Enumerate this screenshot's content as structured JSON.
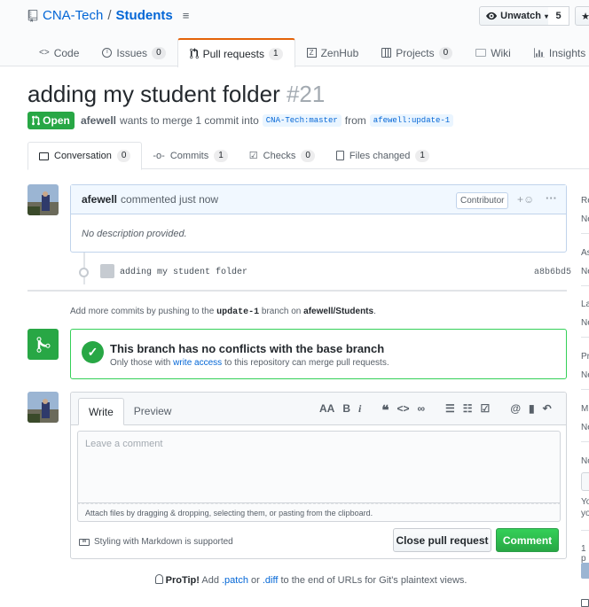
{
  "repo": {
    "owner": "CNA-Tech",
    "separator": "/",
    "name": "Students"
  },
  "watch": {
    "label": "Unwatch",
    "count": "5",
    "star_label": "★"
  },
  "repo_tabs": [
    {
      "label": "Code",
      "count": ""
    },
    {
      "label": "Issues",
      "count": "0"
    },
    {
      "label": "Pull requests",
      "count": "1"
    },
    {
      "label": "ZenHub",
      "count": ""
    },
    {
      "label": "Projects",
      "count": "0"
    },
    {
      "label": "Wiki",
      "count": ""
    },
    {
      "label": "Insights",
      "count": ""
    }
  ],
  "pr": {
    "title": "adding my student folder",
    "number": "#21",
    "state": "Open",
    "author": "afewell",
    "meta_text": "wants to merge 1 commit into",
    "base_ref": "CNA-Tech:master",
    "from_text": "from",
    "head_ref": "afewell:update-1"
  },
  "pr_tabs": [
    {
      "label": "Conversation",
      "count": "0"
    },
    {
      "label": "Commits",
      "count": "1"
    },
    {
      "label": "Checks",
      "count": "0"
    },
    {
      "label": "Files changed",
      "count": "1"
    }
  ],
  "comment": {
    "author": "afewell",
    "action": "commented just now",
    "badge": "Contributor",
    "body": "No description provided."
  },
  "commit": {
    "message": "adding my student folder",
    "sha": "a8b6bd5"
  },
  "push_hint": {
    "prefix": "Add more commits by pushing to the",
    "branch": "update-1",
    "middle": "branch on",
    "repo": "afewell/Students",
    "suffix": "."
  },
  "merge": {
    "title": "This branch has no conflicts with the base branch",
    "desc_prefix": "Only those with",
    "desc_link": "write access",
    "desc_suffix": "to this repository can merge pull requests."
  },
  "editor": {
    "tab_write": "Write",
    "tab_preview": "Preview",
    "placeholder": "Leave a comment",
    "drop_hint": "Attach files by dragging & dropping, selecting them, or pasting from the clipboard.",
    "markdown_note": "Styling with Markdown is supported",
    "close_label": "Close pull request",
    "comment_label": "Comment"
  },
  "protip": {
    "label": "ProTip!",
    "text1": "Add",
    "patch": ".patch",
    "or": "or",
    "diff": ".diff",
    "text2": "to the end of URLs for Git's plaintext views."
  },
  "sidebar_letters": [
    "Re",
    "Ne",
    "As",
    "Ne",
    "La",
    "Ne",
    "Pr",
    "Ne",
    "Mi",
    "Ne",
    "No",
    "Yo",
    "yo",
    "1 p"
  ],
  "colors": {
    "open_green": "#28a745",
    "link_blue": "#0366d6",
    "accent_orange": "#e36209"
  }
}
